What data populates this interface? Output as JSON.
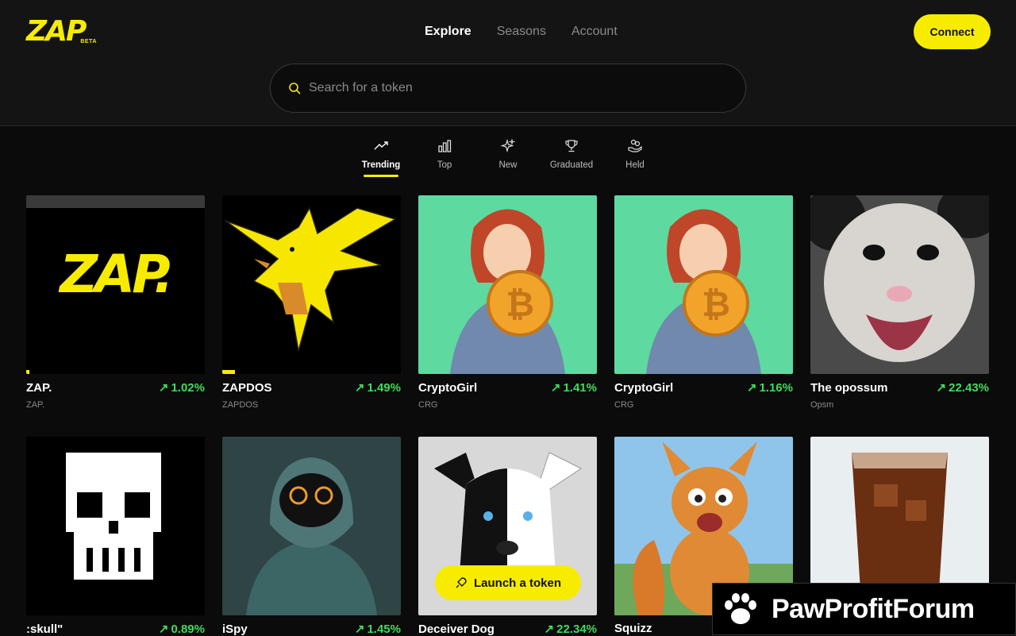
{
  "brand": {
    "logo": "ZAP",
    "badge": "BETA",
    "accent": "#f7ec00"
  },
  "nav": [
    {
      "label": "Explore",
      "active": true
    },
    {
      "label": "Seasons",
      "active": false
    },
    {
      "label": "Account",
      "active": false
    }
  ],
  "connect_label": "Connect",
  "search": {
    "placeholder": "Search for a token",
    "icon": "search-icon"
  },
  "filters": [
    {
      "label": "Trending",
      "icon": "trending-up-icon",
      "active": true
    },
    {
      "label": "Top",
      "icon": "bar-chart-icon",
      "active": false
    },
    {
      "label": "New",
      "icon": "sparkles-icon",
      "active": false
    },
    {
      "label": "Graduated",
      "icon": "trophy-icon",
      "active": false
    },
    {
      "label": "Held",
      "icon": "hand-coins-icon",
      "active": false
    }
  ],
  "tokens": [
    {
      "name": "ZAP.",
      "ticker": "ZAP.",
      "change": "1.02%",
      "image": "zap-logo"
    },
    {
      "name": "ZAPDOS",
      "ticker": "ZAPDOS",
      "change": "1.49%",
      "image": "zapdos-bird"
    },
    {
      "name": "CryptoGirl",
      "ticker": "CRG",
      "change": "1.41%",
      "image": "crypto-girl"
    },
    {
      "name": "CryptoGirl",
      "ticker": "CRG",
      "change": "1.16%",
      "image": "crypto-girl"
    },
    {
      "name": "The opossum",
      "ticker": "Opsm",
      "change": "22.43%",
      "image": "opossum"
    },
    {
      "name": ":skull\"",
      "ticker": "",
      "change": "0.89%",
      "image": "pixel-skull"
    },
    {
      "name": "iSpy",
      "ticker": "",
      "change": "1.45%",
      "image": "hooded-figure"
    },
    {
      "name": "Deceiver Dog",
      "ticker": "",
      "change": "22.34%",
      "image": "dog"
    },
    {
      "name": "Squizz",
      "ticker": "",
      "change": "",
      "image": "squirrel"
    },
    {
      "name": "",
      "ticker": "",
      "change": "",
      "image": "cola-glass"
    }
  ],
  "launch_label": "Launch a token",
  "watermark": {
    "text": "PawProfitForum"
  }
}
